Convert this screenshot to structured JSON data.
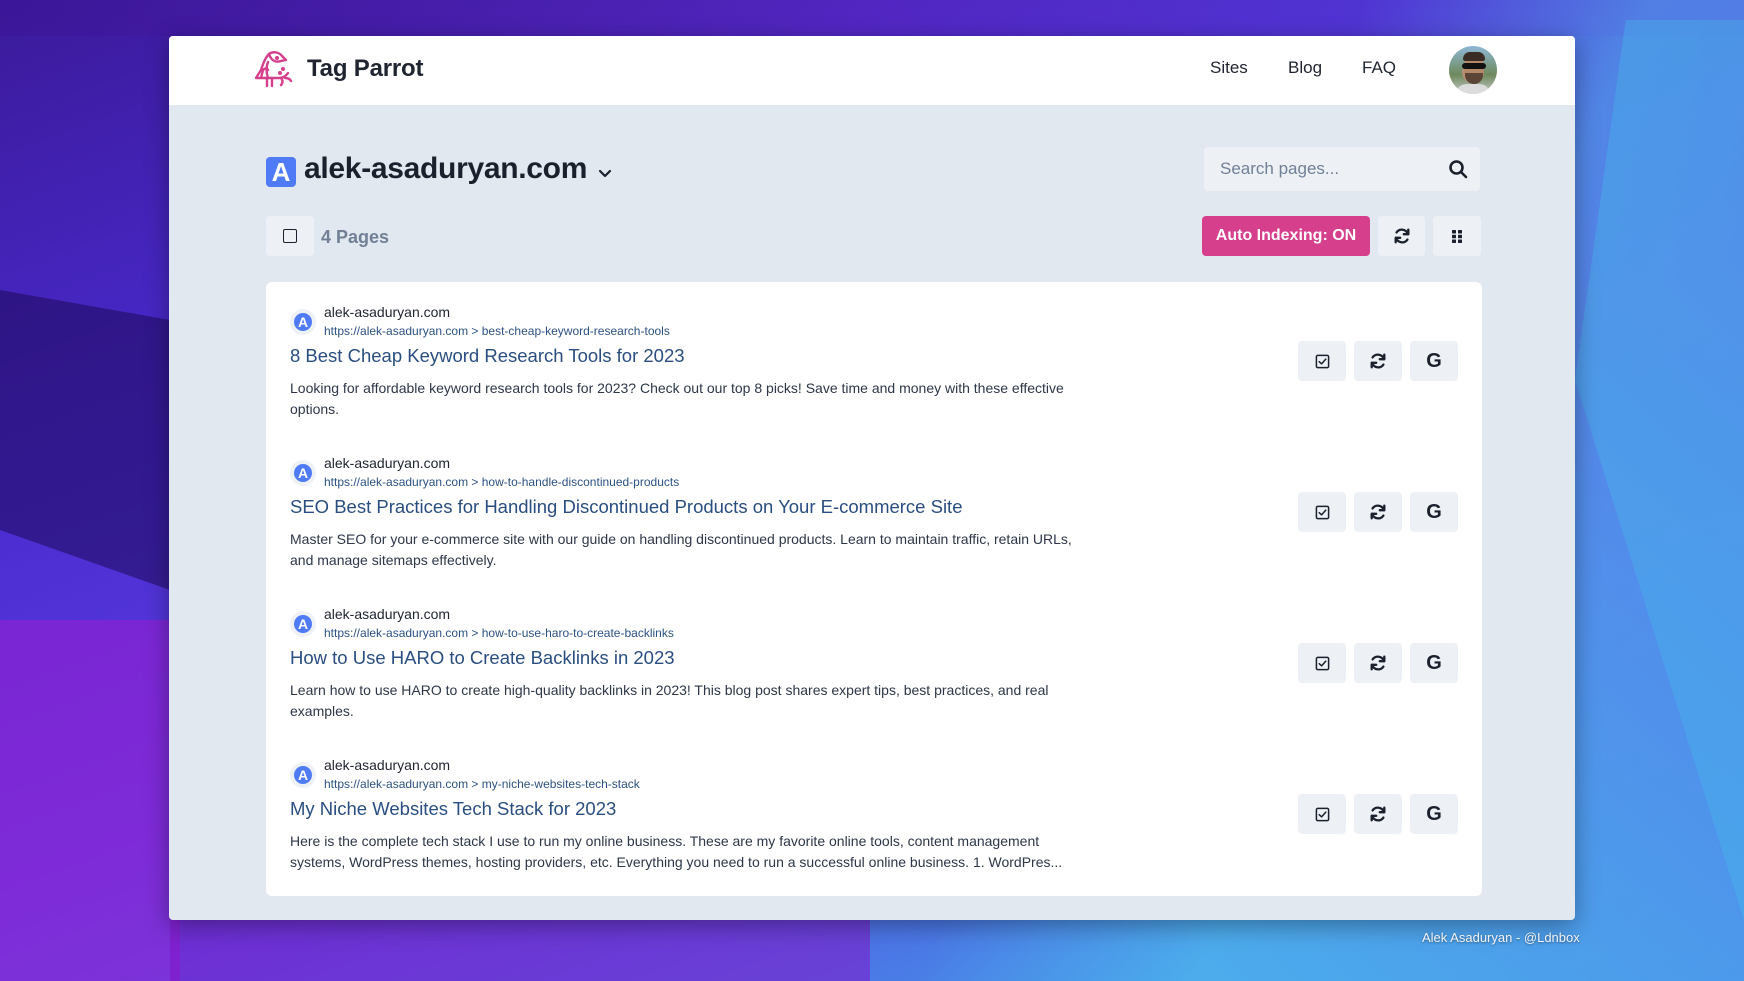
{
  "app": {
    "name": "Tag Parrot",
    "brand_color": "#d63f8c"
  },
  "nav": {
    "items": [
      "Sites",
      "Blog",
      "FAQ"
    ]
  },
  "site": {
    "logo_letter": "A",
    "name": "alek-asaduryan.com"
  },
  "search": {
    "placeholder": "Search pages...",
    "value": ""
  },
  "toolbar": {
    "pages_count": "4 Pages",
    "auto_indexing_label": "Auto Indexing: ON",
    "auto_indexing_on": true
  },
  "pages": [
    {
      "favicon_letter": "A",
      "domain": "alek-asaduryan.com",
      "breadcrumb": "https://alek-asaduryan.com > best-cheap-keyword-research-tools",
      "title": "8 Best Cheap Keyword Research Tools for 2023",
      "description": "Looking for affordable keyword research tools for 2023? Check out our top 8 picks! Save time and money with these effective options."
    },
    {
      "favicon_letter": "A",
      "domain": "alek-asaduryan.com",
      "breadcrumb": "https://alek-asaduryan.com > how-to-handle-discontinued-products",
      "title": "SEO Best Practices for Handling Discontinued Products on Your E-commerce Site",
      "description": "Master SEO for your e-commerce site with our guide on handling discontinued products. Learn to maintain traffic, retain URLs, and manage sitemaps effectively."
    },
    {
      "favicon_letter": "A",
      "domain": "alek-asaduryan.com",
      "breadcrumb": "https://alek-asaduryan.com > how-to-use-haro-to-create-backlinks",
      "title": "How to Use HARO to Create Backlinks in 2023",
      "description": "Learn how to use HARO to create high-quality backlinks in 2023! This blog post shares expert tips, best practices, and real examples."
    },
    {
      "favicon_letter": "A",
      "domain": "alek-asaduryan.com",
      "breadcrumb": "https://alek-asaduryan.com > my-niche-websites-tech-stack",
      "title": "My Niche Websites Tech Stack for 2023",
      "description": "Here is the complete tech stack I use to run my online business. These are my favorite online tools, content management systems, WordPress themes, hosting providers, etc. Everything you need to run a successful online business. 1. WordPres..."
    }
  ],
  "item_actions": {
    "google_label": "G"
  },
  "icons": {
    "logo": "parrot-icon",
    "site_chevron": "chevron-down-icon",
    "search": "search-icon",
    "select_all": "checkbox-icon",
    "refresh": "refresh-icon",
    "grid": "grip-icon",
    "item_check": "checkbox-checked-icon",
    "item_refresh": "refresh-icon",
    "item_google": "google-icon"
  },
  "footer": {
    "credit": "Alek Asaduryan - @Ldnbox"
  }
}
